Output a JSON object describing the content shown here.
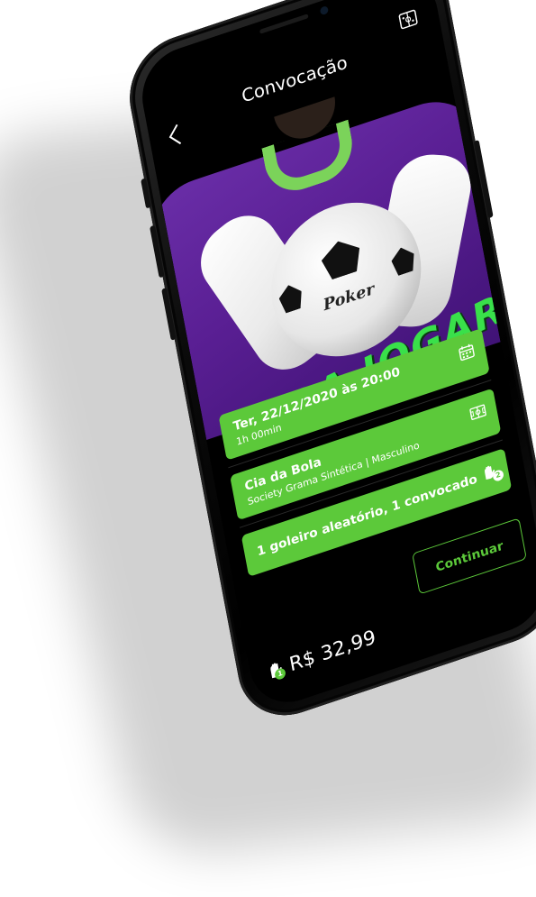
{
  "header": {
    "title": "Convocação",
    "back_icon": "chevron-left-icon",
    "action_icon": "lineup-icon"
  },
  "hero": {
    "slogan": "BORA JOGAR",
    "ball_brand": "Poker"
  },
  "cards": [
    {
      "main": "Ter, 22/12/2020 às 20:00",
      "sub": "1h 00min",
      "icon": "calendar-icon"
    },
    {
      "main": "Cia da Bola",
      "sub": "Society Grama Sintética | Masculino",
      "icon": "field-icon"
    },
    {
      "main": "1 goleiro aleatório, 1 convocado",
      "sub": "",
      "icon": "goalkeeper-glove-icon",
      "badge": "2"
    }
  ],
  "footer": {
    "continue_label": "Continuar",
    "price": "R$ 32,99",
    "price_icon": "goalkeeper-glove-icon",
    "price_badge": "1"
  },
  "colors": {
    "accent": "#5cc93a",
    "background": "#000000",
    "slogan": "#39e04a",
    "jersey": "#5a1f94"
  }
}
